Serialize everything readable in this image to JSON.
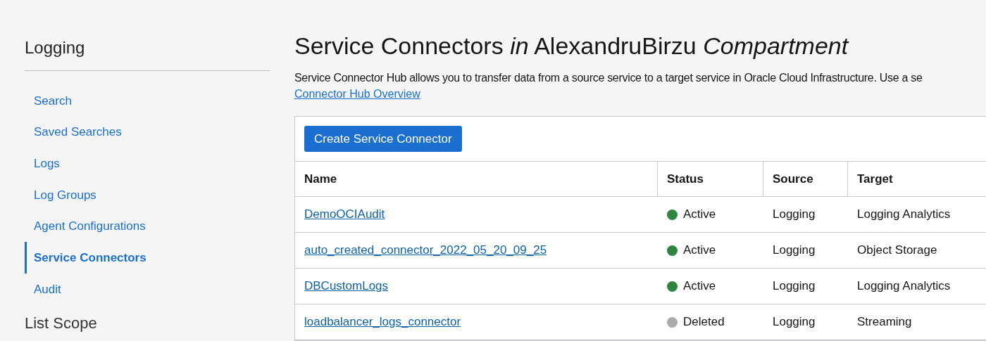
{
  "sidebar": {
    "title": "Logging",
    "items": [
      {
        "label": "Search",
        "selected": false
      },
      {
        "label": "Saved Searches",
        "selected": false
      },
      {
        "label": "Logs",
        "selected": false
      },
      {
        "label": "Log Groups",
        "selected": false
      },
      {
        "label": "Agent Configurations",
        "selected": false
      },
      {
        "label": "Service Connectors",
        "selected": true
      },
      {
        "label": "Audit",
        "selected": false
      }
    ],
    "section_title": "List Scope"
  },
  "page": {
    "title": "Service Connectors *in* AlexandruBirzu *Compartment*",
    "description": "Service Connector Hub allows you to transfer data from a source service to a target service in Oracle Cloud Infrastructure. Use a se",
    "link": "Connector Hub Overview"
  },
  "toolbar": {
    "create_button": "Create Service Connector"
  },
  "table": {
    "columns": [
      "Name",
      "Status",
      "Source",
      "Target"
    ],
    "rows": [
      {
        "name": "DemoOCIAudit",
        "status": "Active",
        "color": "#2e8540",
        "source": "Logging",
        "target": "Logging Analytics"
      },
      {
        "name": "auto_created_connector_2022_05_20_09_25",
        "status": "Active",
        "color": "#2e8540",
        "source": "Logging",
        "target": "Object Storage"
      },
      {
        "name": "DBCustomLogs",
        "status": "Active",
        "color": "#2e8540",
        "source": "Logging",
        "target": "Logging Analytics"
      },
      {
        "name": "loadbalancer_logs_connector",
        "status": "Deleted",
        "color": "#aaaaaa",
        "source": "Logging",
        "target": "Streaming"
      }
    ]
  }
}
